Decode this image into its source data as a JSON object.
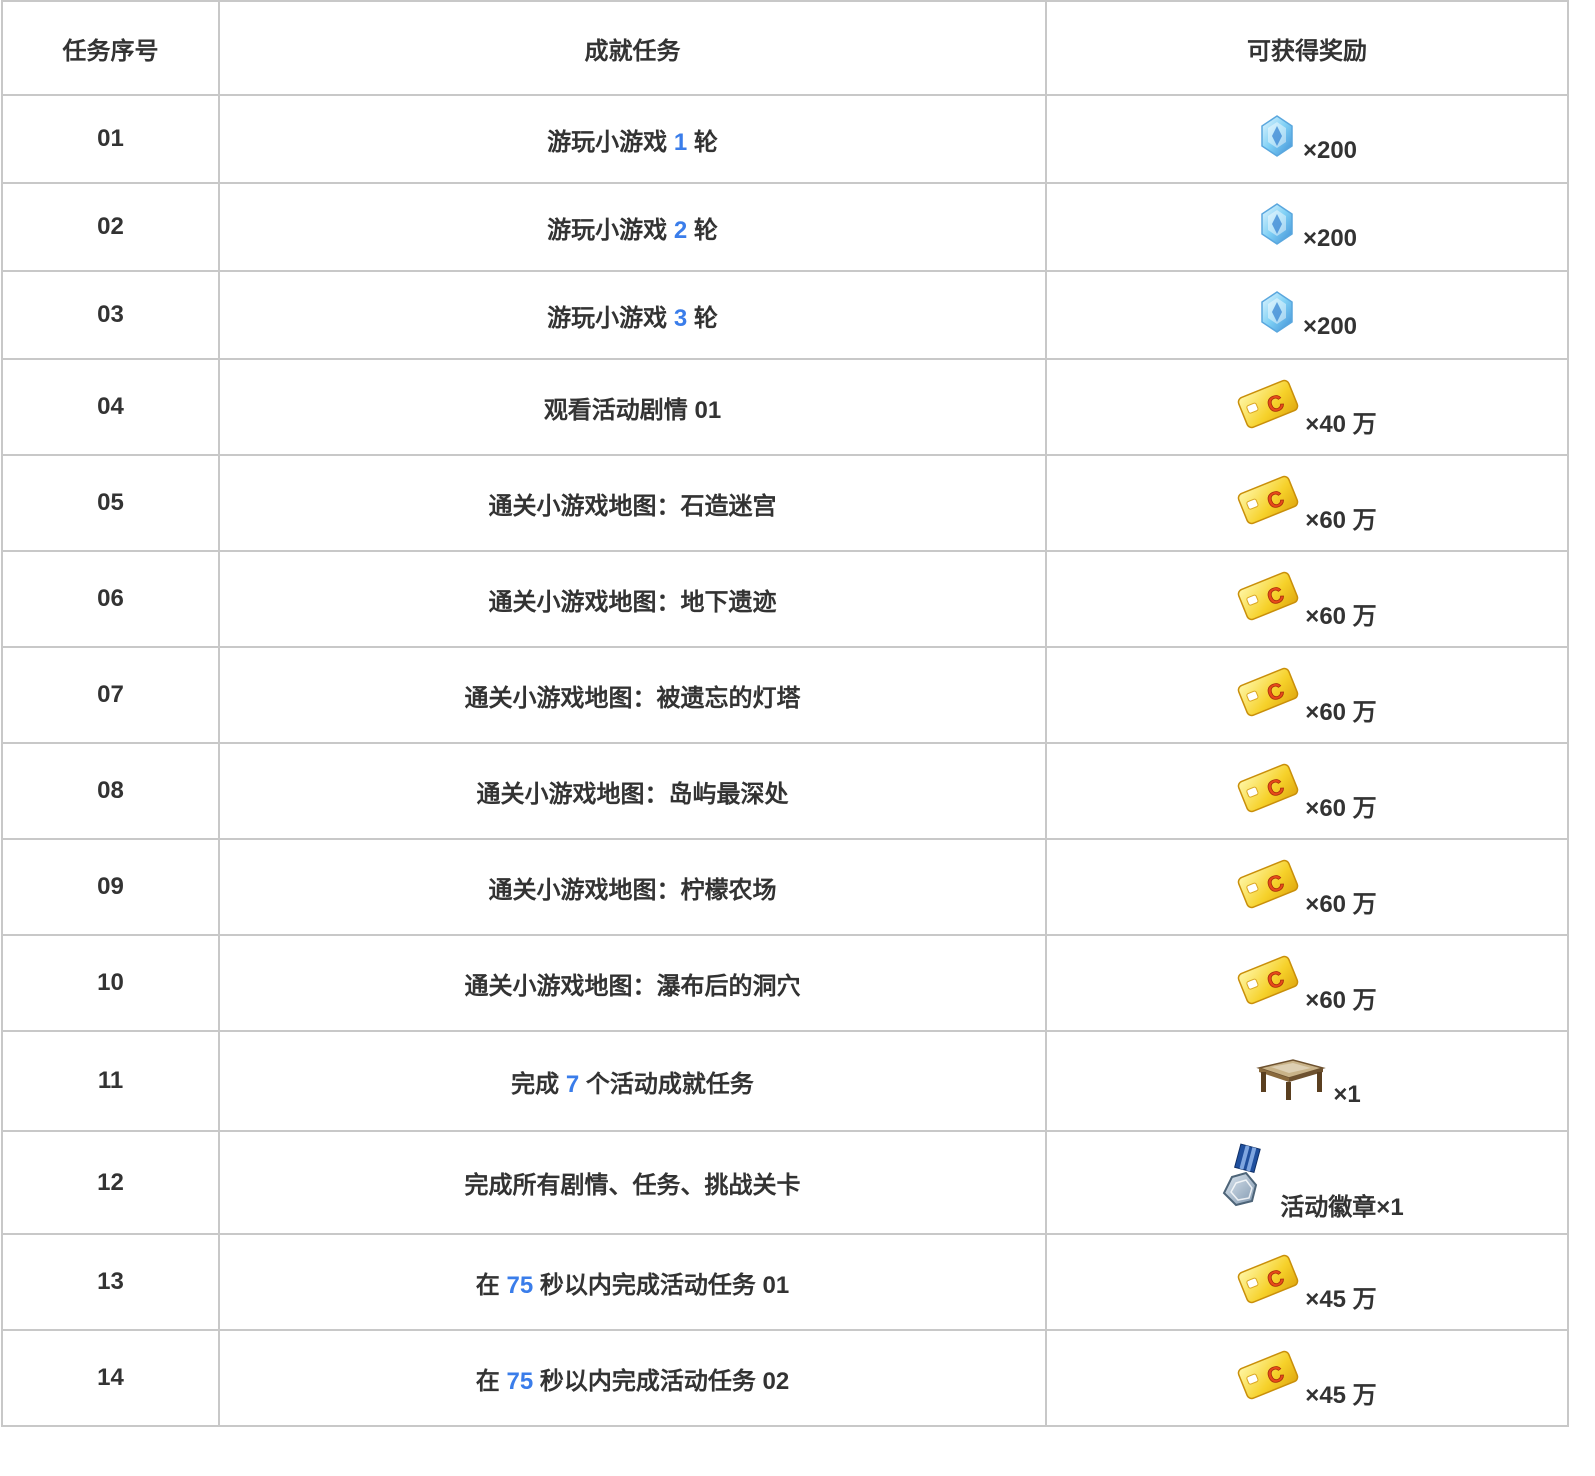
{
  "headers": {
    "index": "任务序号",
    "task": "成就任务",
    "reward": "可获得奖励"
  },
  "colors": {
    "highlight": "#3a7dea",
    "text": "#333333",
    "border": "#c8c8c8"
  },
  "rows": [
    {
      "index": "01",
      "task_pre": "游玩小游戏 ",
      "task_hl": "1",
      "task_post": " 轮",
      "reward_icon": "crystal-icon",
      "reward_amount": "×200"
    },
    {
      "index": "02",
      "task_pre": "游玩小游戏 ",
      "task_hl": "2",
      "task_post": " 轮",
      "reward_icon": "crystal-icon",
      "reward_amount": "×200"
    },
    {
      "index": "03",
      "task_pre": "游玩小游戏 ",
      "task_hl": "3",
      "task_post": " 轮",
      "reward_icon": "crystal-icon",
      "reward_amount": "×200"
    },
    {
      "index": "04",
      "task_pre": "观看活动剧情 01",
      "task_hl": "",
      "task_post": "",
      "reward_icon": "gold-card-icon",
      "reward_amount": "×40 万"
    },
    {
      "index": "05",
      "task_pre": "通关小游戏地图：石造迷宫",
      "task_hl": "",
      "task_post": "",
      "reward_icon": "gold-card-icon",
      "reward_amount": "×60 万"
    },
    {
      "index": "06",
      "task_pre": "通关小游戏地图：地下遗迹",
      "task_hl": "",
      "task_post": "",
      "reward_icon": "gold-card-icon",
      "reward_amount": "×60 万"
    },
    {
      "index": "07",
      "task_pre": "通关小游戏地图：被遗忘的灯塔",
      "task_hl": "",
      "task_post": "",
      "reward_icon": "gold-card-icon",
      "reward_amount": "×60 万"
    },
    {
      "index": "08",
      "task_pre": "通关小游戏地图：岛屿最深处",
      "task_hl": "",
      "task_post": "",
      "reward_icon": "gold-card-icon",
      "reward_amount": "×60 万"
    },
    {
      "index": "09",
      "task_pre": "通关小游戏地图：柠檬农场",
      "task_hl": "",
      "task_post": "",
      "reward_icon": "gold-card-icon",
      "reward_amount": "×60 万"
    },
    {
      "index": "10",
      "task_pre": "通关小游戏地图：瀑布后的洞穴",
      "task_hl": "",
      "task_post": "",
      "reward_icon": "gold-card-icon",
      "reward_amount": "×60 万"
    },
    {
      "index": "11",
      "task_pre": "完成 ",
      "task_hl": "7",
      "task_post": " 个活动成就任务",
      "reward_icon": "furniture-table-icon",
      "reward_amount": "×1"
    },
    {
      "index": "12",
      "task_pre": "完成所有剧情、任务、挑战关卡",
      "task_hl": "",
      "task_post": "",
      "reward_icon": "medal-badge-icon",
      "reward_amount": "活动徽章×1"
    },
    {
      "index": "13",
      "task_pre": "在 ",
      "task_hl": "75",
      "task_post": " 秒以内完成活动任务 01",
      "reward_icon": "gold-card-icon",
      "reward_amount": "×45 万"
    },
    {
      "index": "14",
      "task_pre": "在 ",
      "task_hl": "75",
      "task_post": " 秒以内完成活动任务 02",
      "reward_icon": "gold-card-icon",
      "reward_amount": "×45 万"
    }
  ]
}
